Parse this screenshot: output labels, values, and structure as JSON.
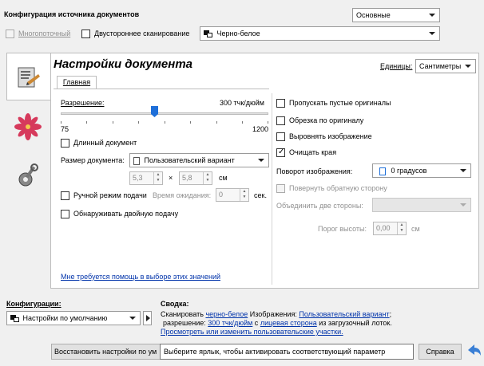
{
  "header": {
    "title": "Конфигурация источника документов",
    "mode_value": "Основные",
    "multistream_label": "Многопоточный",
    "duplex_label": "Двустороннее сканирование",
    "color_value": "Черно-белое"
  },
  "sidebar": {
    "tabs": [
      {
        "name": "document-settings"
      },
      {
        "name": "image-settings"
      },
      {
        "name": "device-settings"
      }
    ]
  },
  "doc": {
    "title": "Настройки документа",
    "units_label": "Единицы:",
    "units_value": "Сантиметры",
    "tab_main": "Главная",
    "resolution_label": "Разрешение:",
    "resolution_value": "300 тчк/дюйм",
    "resolution_min": "75",
    "resolution_max": "1200",
    "resolution_fraction": 0.45,
    "long_doc_label": "Длинный документ",
    "doc_size_label": "Размер документа:",
    "doc_size_value": "Пользовательский вариант",
    "width_value": "5,3",
    "times_sign": "×",
    "height_value": "5,8",
    "size_unit": "см",
    "manual_feed_label": "Ручной режим подачи",
    "wait_time_label": "Время ожидания:",
    "wait_time_value": "0",
    "wait_time_unit": "сек.",
    "double_feed_label": "Обнаруживать двойную подачу",
    "skip_blank_label": "Пропускать пустые оригиналы",
    "crop_label": "Обрезка по оригиналу",
    "deskew_label": "Выровнять изображение",
    "clean_edges_label": "Очищать края",
    "rotation_label": "Поворот изображения:",
    "rotation_value": "0 градусов",
    "flip_back_label": "Повернуть обратную сторону",
    "merge_sides_label": "Объединить две стороны:",
    "merge_sides_value": "",
    "threshold_label": "Порог высоты:",
    "threshold_value": "0,00",
    "threshold_unit": "см",
    "help_link": "Мне требуется помощь в выборе этих значений"
  },
  "bottom": {
    "configs_label": "Конфигурации:",
    "config_value": "Настройки по умолчанию",
    "summary_label": "Сводка:",
    "summary_scan": "Сканировать",
    "summary_color": "черно-белое",
    "summary_images": "Изображения:",
    "summary_custom": "Пользовательский вариант",
    "summary_semicolon": ";",
    "summary_res": "разрешение:",
    "summary_dpi": "300 тчк/дюйм",
    "summary_with": "с",
    "summary_front": "лицевая сторона",
    "summary_from": "из загрузочный лоток.",
    "summary_link": "Просмотреть или изменить пользовательские участки.",
    "restore_button": "Восстановить настройки по ум",
    "tooltip": "Выберите ярлык, чтобы активировать соответствующий параметр",
    "help_button": "Справка"
  },
  "colors": {
    "link": "#0033aa",
    "slider_thumb": "#1e6fd9",
    "back_arrow": "#3a7fd5"
  }
}
